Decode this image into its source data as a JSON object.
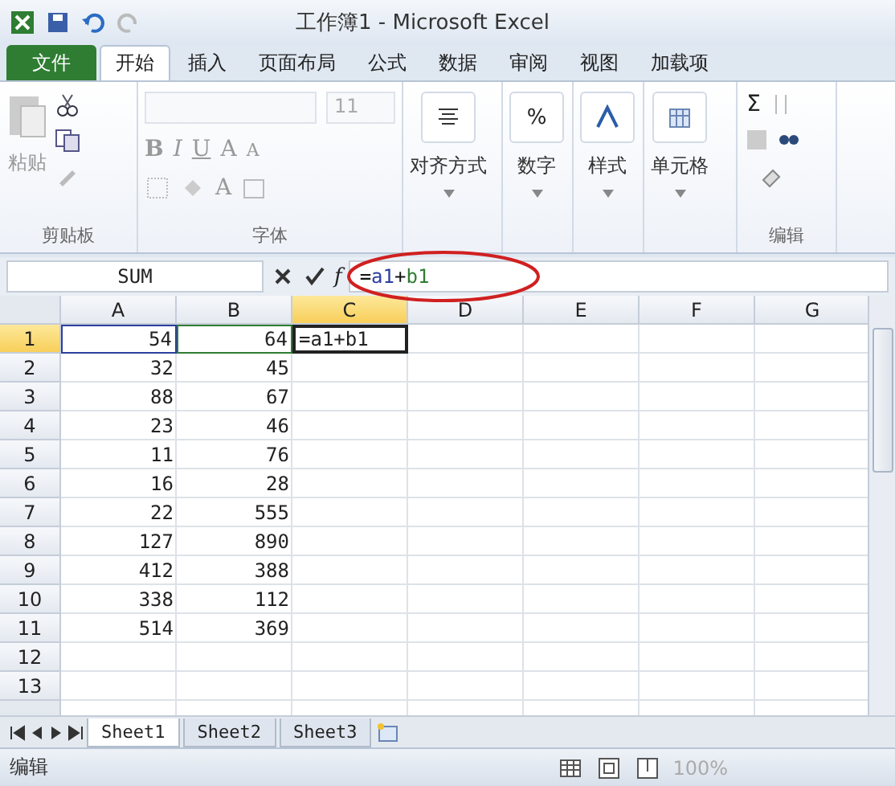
{
  "window": {
    "title": "工作簿1 - Microsoft Excel"
  },
  "ribbon_tabs": [
    {
      "label": "文件",
      "kind": "file",
      "selected": false
    },
    {
      "label": "开始",
      "kind": "tab",
      "selected": true
    },
    {
      "label": "插入",
      "kind": "tab",
      "selected": false
    },
    {
      "label": "页面布局",
      "kind": "tab",
      "selected": false
    },
    {
      "label": "公式",
      "kind": "tab",
      "selected": false
    },
    {
      "label": "数据",
      "kind": "tab",
      "selected": false
    },
    {
      "label": "审阅",
      "kind": "tab",
      "selected": false
    },
    {
      "label": "视图",
      "kind": "tab",
      "selected": false
    },
    {
      "label": "加载项",
      "kind": "tab",
      "selected": false
    }
  ],
  "clipboard": {
    "group_label": "剪贴板",
    "paste_label": "粘贴"
  },
  "font": {
    "group_label": "字体",
    "font_size": "11",
    "buttons": [
      {
        "kind": "bold",
        "label": "B"
      },
      {
        "kind": "italic",
        "label": "I"
      },
      {
        "kind": "underline",
        "label": "U"
      },
      {
        "kind": "grow",
        "label": "A"
      },
      {
        "kind": "shrink",
        "label": "A"
      }
    ],
    "font_color_label": "A"
  },
  "big_groups": [
    {
      "kind": "align",
      "label": "对齐方式"
    },
    {
      "kind": "number",
      "label": "数字",
      "glyph": "%"
    },
    {
      "kind": "styles",
      "label": "样式"
    },
    {
      "kind": "cells",
      "label": "单元格"
    }
  ],
  "editing": {
    "group_label": "编辑",
    "sum_label": "Σ"
  },
  "formula_bar": {
    "name_box": "SUM",
    "fx_label": "f",
    "formula": [
      {
        "text": "=",
        "kind": "plain"
      },
      {
        "text": "a1",
        "kind": "ref",
        "color": "#2b3f9e"
      },
      {
        "text": "+",
        "kind": "plain"
      },
      {
        "text": "b1",
        "kind": "ref",
        "color": "#2e7d32"
      }
    ]
  },
  "columns": [
    {
      "label": "A",
      "selected": false
    },
    {
      "label": "B",
      "selected": false
    },
    {
      "label": "C",
      "selected": true
    },
    {
      "label": "D",
      "selected": false
    },
    {
      "label": "E",
      "selected": false
    },
    {
      "label": "F",
      "selected": false
    },
    {
      "label": "G",
      "selected": false
    }
  ],
  "rows": [
    {
      "label": "1",
      "selected": true,
      "cells": [
        {
          "value": "54",
          "color": "#2b3f9e"
        },
        {
          "value": "64",
          "color": "#2e7d32"
        },
        {
          "value": "=a1+b1",
          "kind": "text",
          "active": true
        }
      ]
    },
    {
      "label": "2",
      "selected": false,
      "cells": [
        {
          "value": "32"
        },
        {
          "value": "45"
        }
      ]
    },
    {
      "label": "3",
      "selected": false,
      "cells": [
        {
          "value": "88"
        },
        {
          "value": "67"
        }
      ]
    },
    {
      "label": "4",
      "selected": false,
      "cells": [
        {
          "value": "23"
        },
        {
          "value": "46"
        }
      ]
    },
    {
      "label": "5",
      "selected": false,
      "cells": [
        {
          "value": "11"
        },
        {
          "value": "76"
        }
      ]
    },
    {
      "label": "6",
      "selected": false,
      "cells": [
        {
          "value": "16"
        },
        {
          "value": "28"
        }
      ]
    },
    {
      "label": "7",
      "selected": false,
      "cells": [
        {
          "value": "22"
        },
        {
          "value": "555"
        }
      ]
    },
    {
      "label": "8",
      "selected": false,
      "cells": [
        {
          "value": "127"
        },
        {
          "value": "890"
        }
      ]
    },
    {
      "label": "9",
      "selected": false,
      "cells": [
        {
          "value": "412"
        },
        {
          "value": "388"
        }
      ]
    },
    {
      "label": "10",
      "selected": false,
      "cells": [
        {
          "value": "338"
        },
        {
          "value": "112"
        }
      ]
    },
    {
      "label": "11",
      "selected": false,
      "cells": [
        {
          "value": "514"
        },
        {
          "value": "369"
        }
      ]
    },
    {
      "label": "12",
      "selected": false,
      "cells": []
    },
    {
      "label": "13",
      "selected": false,
      "cells": []
    }
  ],
  "sheet_tabs": [
    {
      "label": "Sheet1",
      "selected": true
    },
    {
      "label": "Sheet2",
      "selected": false
    },
    {
      "label": "Sheet3",
      "selected": false
    }
  ],
  "status_bar": {
    "mode": "编辑",
    "zoom": "100%"
  }
}
